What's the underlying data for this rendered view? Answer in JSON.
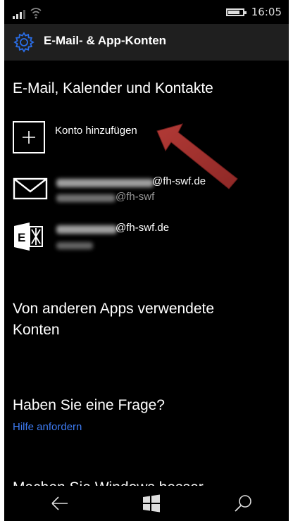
{
  "statusbar": {
    "time": "16:05",
    "signal_level": 3,
    "battery_level": 0.75
  },
  "header": {
    "title": "E-Mail- & App-Konten",
    "icon": "gear-icon",
    "accent": "#2a6de6"
  },
  "section_mail": {
    "title": "E-Mail, Kalender und Kontakte",
    "add_label": "Konto hinzufügen",
    "accounts": [
      {
        "type": "mail-icon",
        "line1": "@fh-swf.de",
        "line2": "@fh-swf"
      },
      {
        "type": "exchange-icon",
        "line1": "@fh-swf.de",
        "line2": ""
      }
    ]
  },
  "section_apps": {
    "title_line1": "Von anderen Apps verwendete",
    "title_line2": "Konten"
  },
  "section_help": {
    "title": "Haben Sie eine Frage?",
    "link": "Hilfe anfordern",
    "link_color": "#3d7bf2"
  },
  "section_cut": {
    "title": "Machen Sie Windows besser"
  },
  "annotation": {
    "arrow_color": "#a0302e"
  },
  "navbar": {
    "back": "back-icon",
    "start": "windows-logo-icon",
    "search": "search-icon"
  }
}
